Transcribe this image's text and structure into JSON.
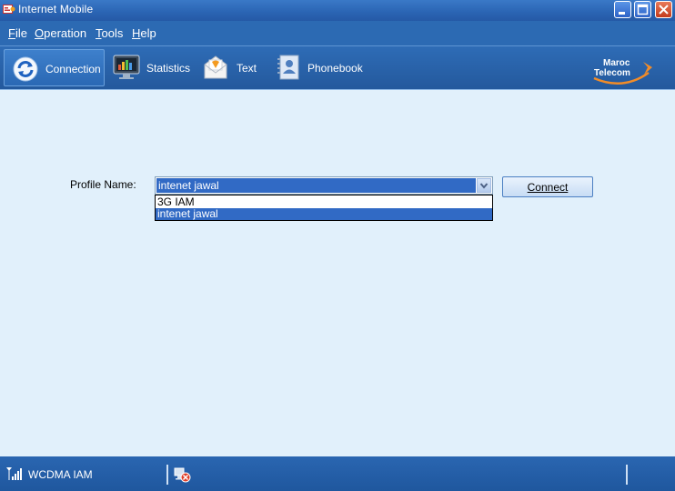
{
  "window": {
    "title": "Internet Mobile"
  },
  "menu": [
    {
      "label": "File",
      "mnemonic": "F",
      "rest": "ile"
    },
    {
      "label": "Operation",
      "mnemonic": "O",
      "rest": "peration"
    },
    {
      "label": "Tools",
      "mnemonic": "T",
      "rest": "ools"
    },
    {
      "label": "Help",
      "mnemonic": "H",
      "rest": "elp"
    }
  ],
  "toolbar": {
    "connection": "Connection",
    "statistics": "Statistics",
    "text": "Text",
    "phonebook": "Phonebook"
  },
  "logo": {
    "line1": "Maroc",
    "line2": "Telecom"
  },
  "profile": {
    "label": "Profile Name:",
    "selected": "intenet jawal",
    "options": [
      "3G IAM",
      "intenet jawal"
    ],
    "connect_label": "Connect"
  },
  "status": {
    "network": "WCDMA  IAM"
  },
  "colors": {
    "accent": "#316ac5",
    "bar": "#2c6ab3",
    "content_bg": "#e1f0fb"
  }
}
